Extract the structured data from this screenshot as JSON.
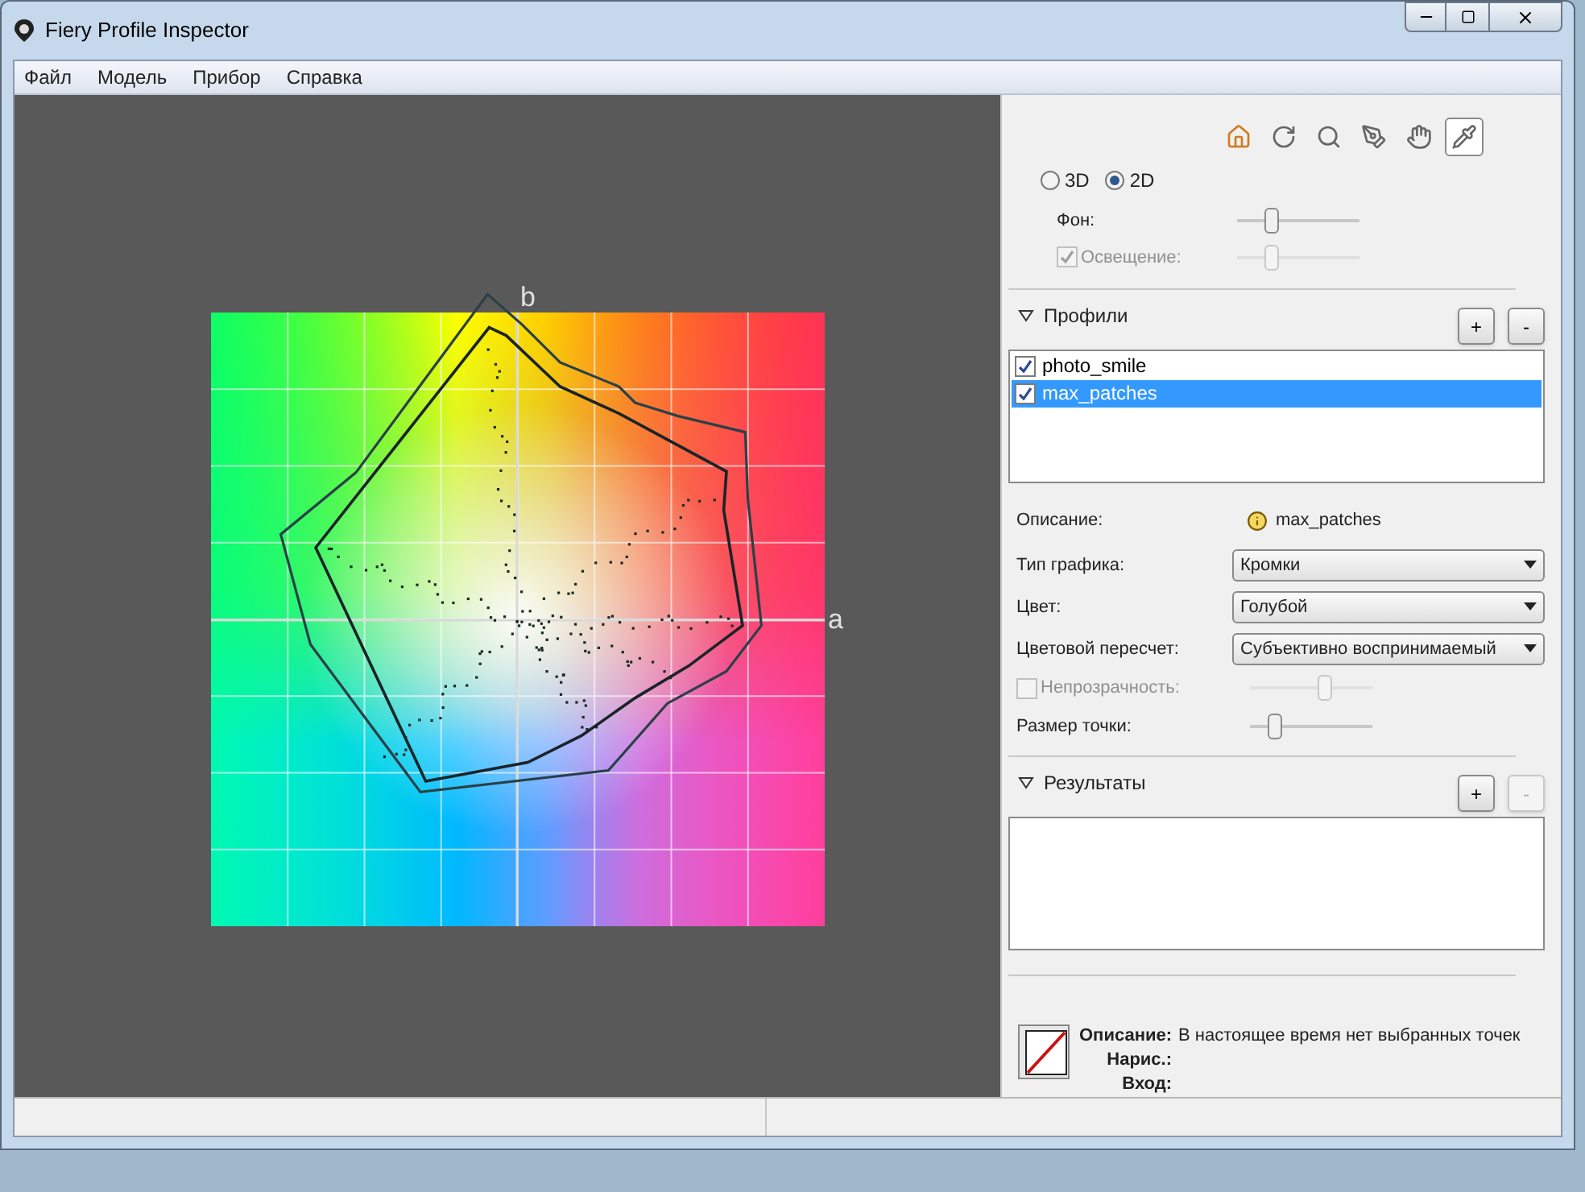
{
  "window": {
    "title": "Fiery Profile Inspector"
  },
  "menu": [
    "Файл",
    "Модель",
    "Прибор",
    "Справка"
  ],
  "plot": {
    "axis_b": "b",
    "axis_a": "a"
  },
  "toolbar": [
    {
      "kind": "home",
      "selected": false
    },
    {
      "kind": "rotate",
      "selected": false
    },
    {
      "kind": "zoom",
      "selected": false
    },
    {
      "kind": "pen",
      "selected": false
    },
    {
      "kind": "hand",
      "selected": false
    },
    {
      "kind": "eyedropper",
      "selected": true
    }
  ],
  "view_modes": [
    {
      "label": "3D",
      "selected": false
    },
    {
      "label": "2D",
      "selected": true
    }
  ],
  "background": {
    "label": "Фон:",
    "level": 0.28
  },
  "lighting": {
    "label": "Освещение:",
    "checked": true,
    "disabled": true,
    "level": 0.28
  },
  "profiles": {
    "title": "Профили",
    "expanded": true,
    "add": "+",
    "remove": "-",
    "items": [
      {
        "name": "photo_smile",
        "checked": true,
        "selected": false
      },
      {
        "name": "max_patches",
        "checked": true,
        "selected": true
      }
    ]
  },
  "description": {
    "label": "Описание:",
    "value": "max_patches"
  },
  "dropdowns": [
    {
      "label": "Тип графика:",
      "value": "Кромки"
    },
    {
      "label": "Цвет:",
      "value": "Голубой"
    },
    {
      "label": "Цветовой пересчет:",
      "value": "Субъективно воспринимаемый"
    }
  ],
  "opacity": {
    "label": "Непрозрачность:",
    "checked": false,
    "disabled": true,
    "level": 0.6
  },
  "point_size": {
    "label": "Размер точки:",
    "level": 0.2
  },
  "results": {
    "title": "Результаты",
    "expanded": true,
    "add": "+",
    "remove": "-",
    "remove_disabled": true
  },
  "selection_info": [
    {
      "label": "Описание:",
      "value": "В настоящее время нет выбранных точек"
    },
    {
      "label": "Нарис.:"
    },
    {
      "label": "Вход:"
    }
  ]
}
